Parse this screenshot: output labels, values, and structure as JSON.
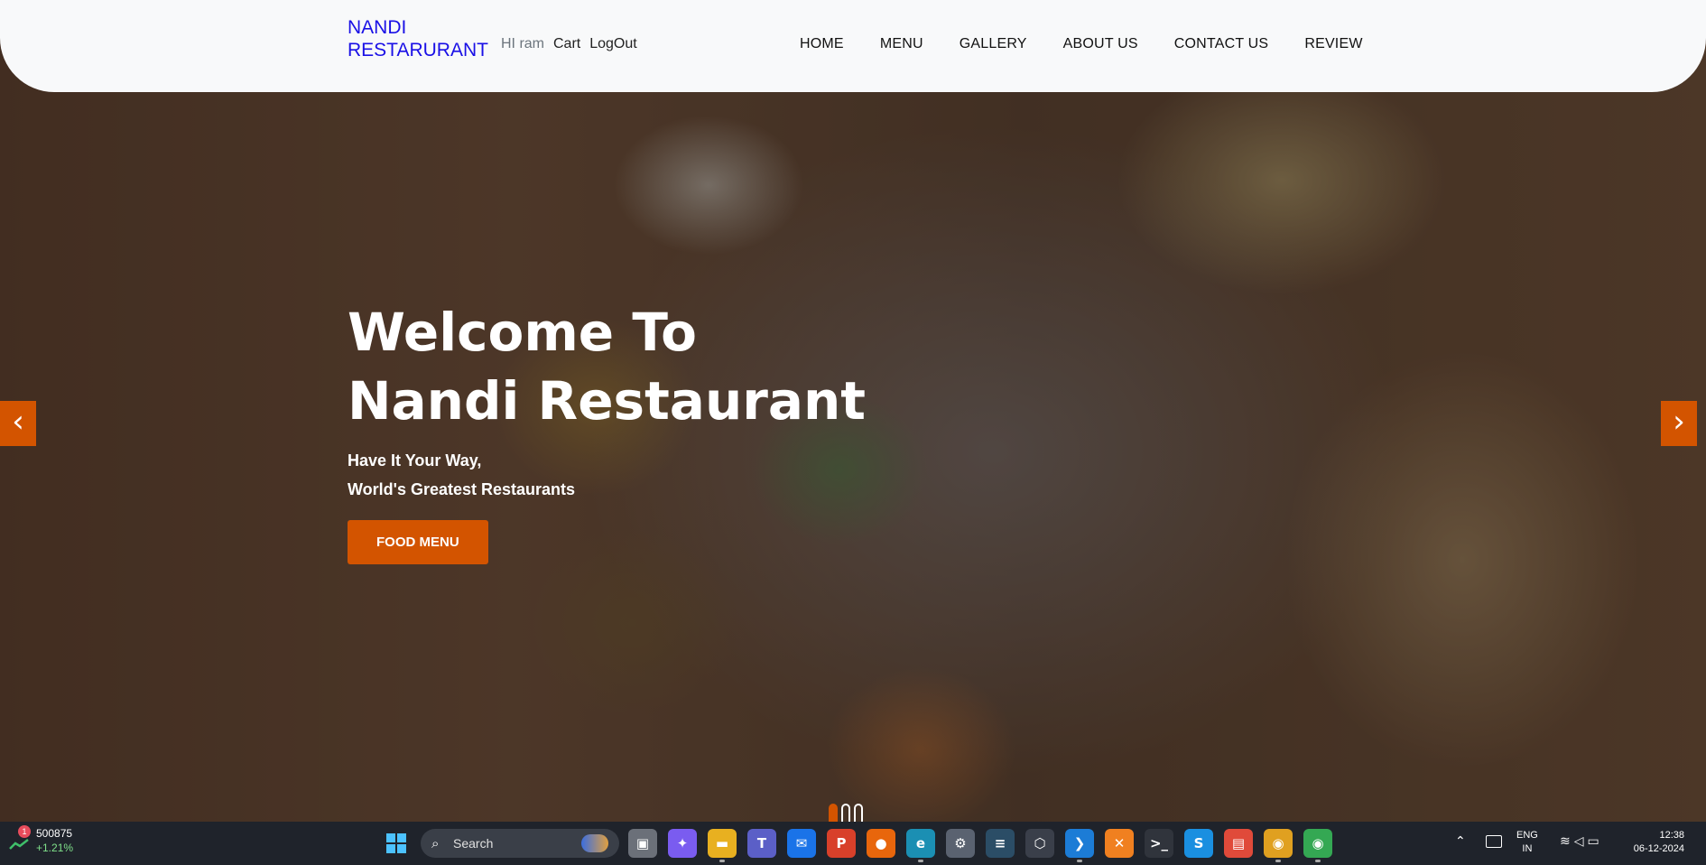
{
  "navbar": {
    "brand_line1": "NANDI",
    "brand_line2": "RESTARURANT",
    "greeting": "HI ram",
    "cart": "Cart",
    "logout": "LogOut",
    "menu": [
      "HOME",
      "MENU",
      "GALLERY",
      "ABOUT US",
      "CONTACT US",
      "REVIEW"
    ]
  },
  "hero": {
    "title_line1": "Welcome To",
    "title_line2": "Nandi Restaurant",
    "subtitle_line1": "Have It Your Way,",
    "subtitle_line2": "World's Greatest Restaurants",
    "button": "FOOD MENU",
    "prev_arrow": "‹",
    "next_arrow": "›"
  },
  "colors": {
    "accent": "#d35400",
    "brand": "#1a10e6",
    "navbar_bg": "#f8f9fa",
    "taskbar_bg": "#1f232b"
  },
  "taskbar": {
    "stock_badge": "1",
    "stock_value": "500875",
    "stock_change": "+1.21%",
    "search_placeholder": "Search",
    "apps": [
      {
        "name": "task-view-icon",
        "glyph": "▣",
        "color": "#6b7079"
      },
      {
        "name": "copilot-icon",
        "glyph": "✦",
        "color": "#7a5cf0"
      },
      {
        "name": "file-explorer-icon",
        "glyph": "▬",
        "color": "#e8b020"
      },
      {
        "name": "teams-icon",
        "glyph": "T",
        "color": "#5b5fc7"
      },
      {
        "name": "mail-icon",
        "glyph": "✉",
        "color": "#1a73e8"
      },
      {
        "name": "wps-icon",
        "glyph": "P",
        "color": "#d8402a"
      },
      {
        "name": "firefox-icon",
        "glyph": "●",
        "color": "#e8660c"
      },
      {
        "name": "edge-icon",
        "glyph": "e",
        "color": "#1b8fb3"
      },
      {
        "name": "settings-icon",
        "glyph": "⚙",
        "color": "#5a6270"
      },
      {
        "name": "mysql-icon",
        "glyph": "≡",
        "color": "#2b4d66"
      },
      {
        "name": "app-hex-icon",
        "glyph": "⬡",
        "color": "#3a3f4a"
      },
      {
        "name": "vscode-icon",
        "glyph": "❯",
        "color": "#1c7cd6"
      },
      {
        "name": "xampp-icon",
        "glyph": "✕",
        "color": "#f08020"
      },
      {
        "name": "terminal-icon",
        "glyph": ">_",
        "color": "#30343c"
      },
      {
        "name": "skype-icon",
        "glyph": "S",
        "color": "#1a8fe0"
      },
      {
        "name": "document-app-icon",
        "glyph": "▤",
        "color": "#e04a3a"
      },
      {
        "name": "chrome-icon",
        "glyph": "◉",
        "color": "#e0a020"
      },
      {
        "name": "chrome-profile-icon",
        "glyph": "◉",
        "color": "#34a853"
      }
    ],
    "lang_line1": "ENG",
    "lang_line2": "IN",
    "time": "12:38",
    "date": "06-12-2024"
  }
}
